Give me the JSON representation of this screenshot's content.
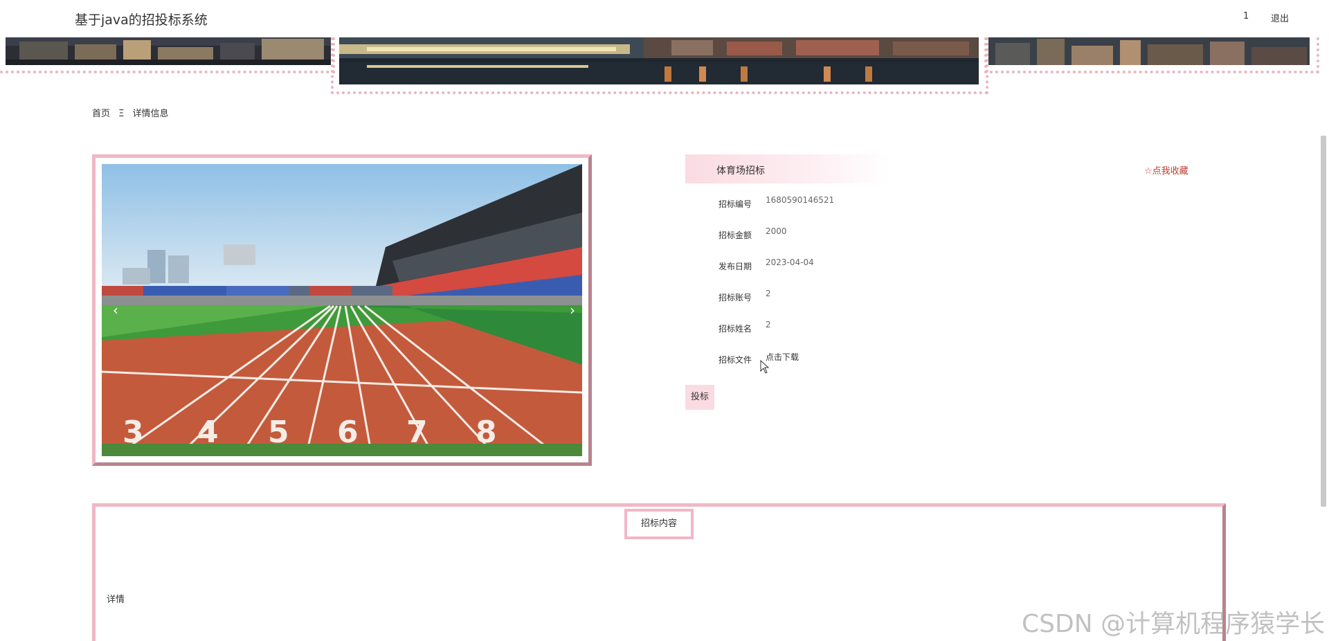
{
  "header": {
    "system_title": "基于java的招投标系统",
    "user_name": "1",
    "logout_label": "退出"
  },
  "breadcrumb": {
    "home": "首页",
    "separator": "Ξ",
    "current": "详情信息"
  },
  "detail": {
    "title": "体育场招标",
    "favorite_label": "☆点我收藏",
    "fields": [
      {
        "label": "招标编号",
        "value": "1680590146521"
      },
      {
        "label": "招标金额",
        "value": "2000"
      },
      {
        "label": "发布日期",
        "value": "2023-04-04"
      },
      {
        "label": "招标账号",
        "value": "2"
      },
      {
        "label": "招标姓名",
        "value": "2"
      },
      {
        "label": "招标文件",
        "value": "点击下载"
      }
    ],
    "bid_button": "投标"
  },
  "gallery": {
    "prev_icon": "‹",
    "next_icon": "›",
    "lane_numbers": [
      "3",
      "4",
      "5",
      "6",
      "7",
      "8"
    ]
  },
  "content": {
    "tab_label": "招标内容",
    "body_text": "详情"
  },
  "watermark": "CSDN @计算机程序猿学长",
  "colors": {
    "accent_pink": "#f1b7c6",
    "accent_dark": "#b9828f",
    "favorite_red": "#c0392b"
  }
}
